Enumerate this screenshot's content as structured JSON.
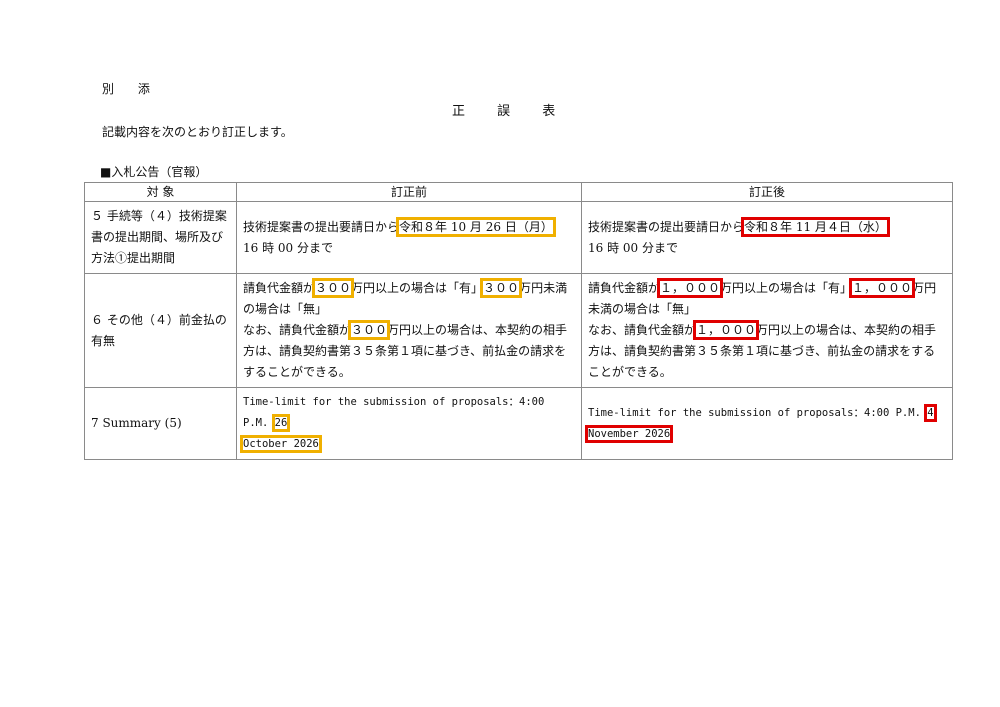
{
  "header": {
    "annex": "別 添",
    "title": "正 誤 表",
    "intro": "記載内容を次のとおり訂正します。",
    "section": "■入札公告（官報）"
  },
  "table": {
    "columns": [
      "対 象",
      "訂正前",
      "訂正後"
    ],
    "rows": [
      {
        "subject": "５ 手続等（４）技術提案書の提出期間、場所及び方法①提出期間",
        "before": {
          "pre": "技術提案書の提出要請日から",
          "hl": "令和８年 10 月 26 日（月）",
          "post": "16 時 00 分まで"
        },
        "after": {
          "pre": "技術提案書の提出要請日から",
          "hl": "令和８年 11 月４日（水）",
          "post": "16 時 00 分まで"
        }
      },
      {
        "subject": "６ その他（４）前金払の有無",
        "before": {
          "p1": "請負代金額が",
          "v1": "３００",
          "p2": "万円以上の場合は「有」",
          "v2": "３００",
          "p3": "万円未満の場合は「無」",
          "p4": "なお、請負代金額が",
          "v3": "３００",
          "p5": "万円以上の場合は、本契約の相手方は、請負契約書第３５条第１項に基づき、前払金の請求をすることができる。"
        },
        "after": {
          "p1": "請負代金額が",
          "v1": "１，０００",
          "p2": "万円以上の場合は「有」",
          "v2": "１，０００",
          "p3": "万円未満の場合は「無」",
          "p4": "なお、請負代金額が",
          "v3": "１，０００",
          "p5": "万円以上の場合は、本契約の相手方は、請負契約書第３５条第１項に基づき、前払金の請求をすることができる。"
        }
      },
      {
        "subject": "7 Summary (5)",
        "before": {
          "pre": "Time-limit for the submission of proposals：4:00 P.M.",
          "day": "26",
          "month": "October 2026"
        },
        "after": {
          "pre": "Time-limit for the submission of proposals：4:00 P.M.",
          "day": "4",
          "month": "November 2026"
        }
      }
    ]
  },
  "colors": {
    "before_highlight": "#f0b000",
    "after_highlight": "#e00000",
    "border": "#8a8a8a"
  }
}
